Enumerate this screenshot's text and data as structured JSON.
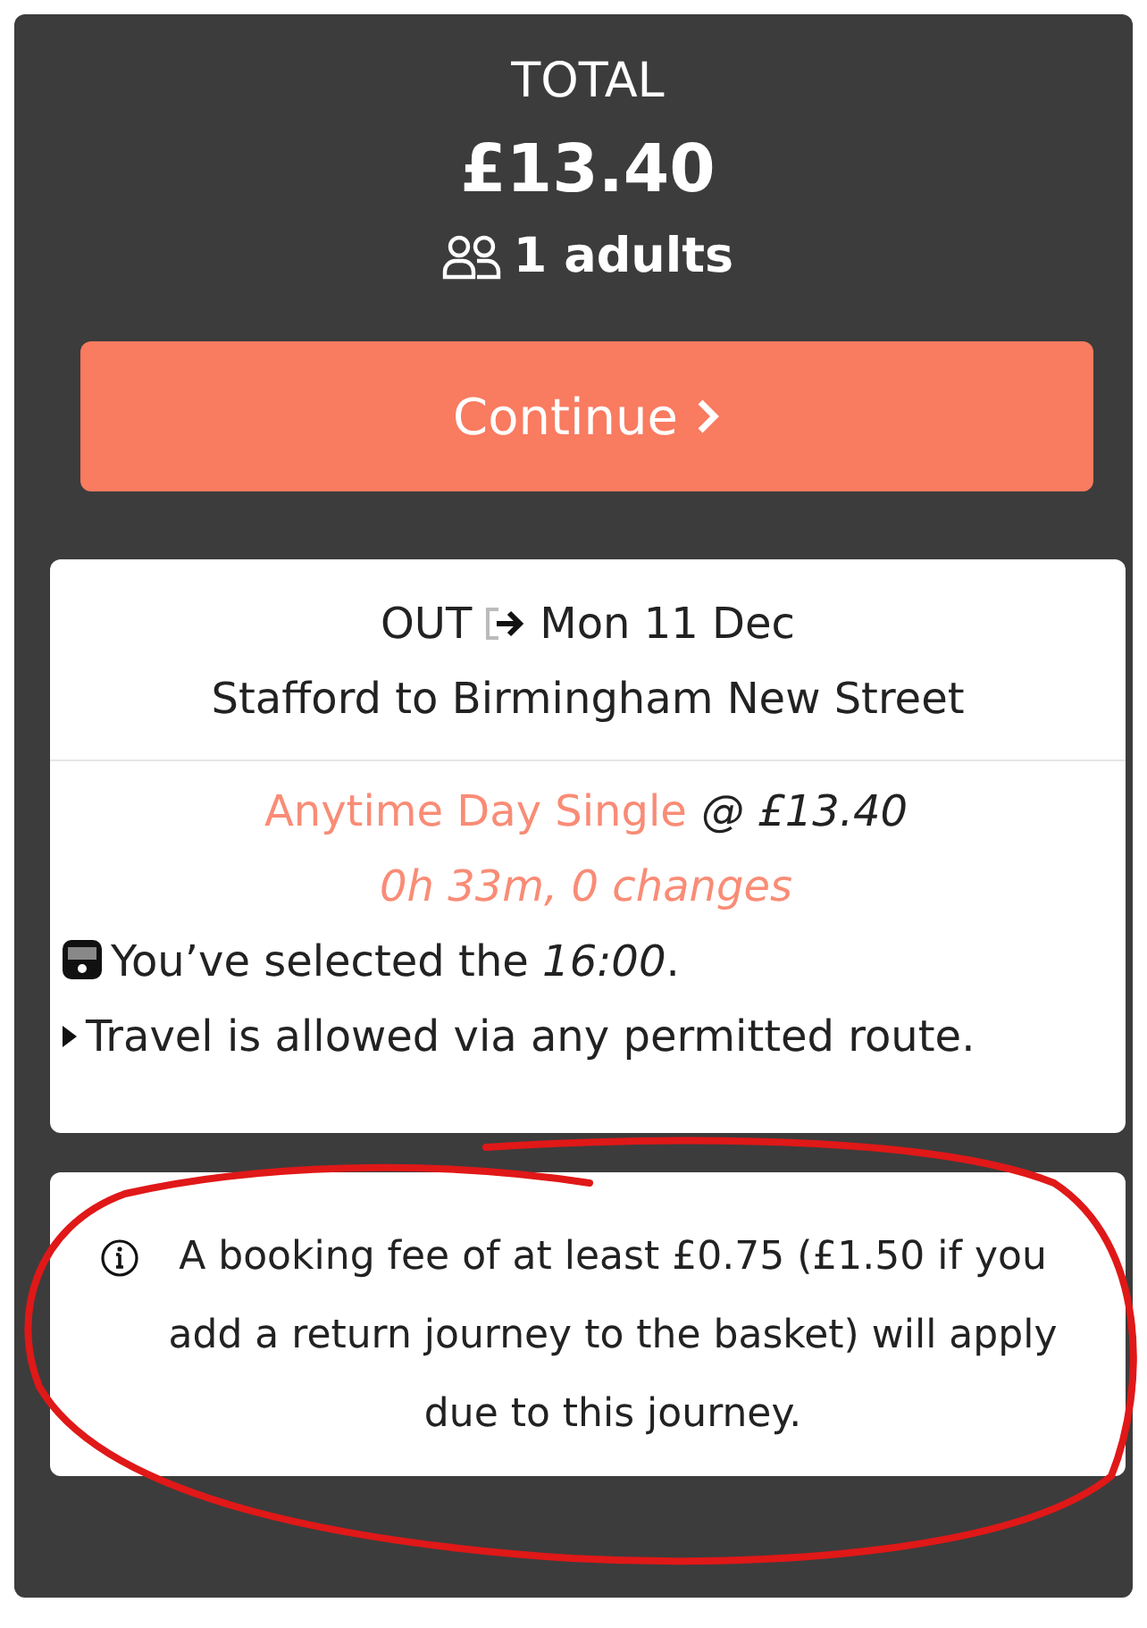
{
  "total": {
    "label": "TOTAL",
    "amount": "£13.40",
    "passengers": "1 adults"
  },
  "continue_button": {
    "label": "Continue"
  },
  "journey": {
    "direction": "OUT",
    "date": "Mon 11 Dec",
    "route": "Stafford to Birmingham New Street",
    "fare_name": "Anytime Day Single",
    "fare_price": "@ £13.40",
    "duration": "0h 33m, 0 changes",
    "notes": [
      {
        "kind": "train",
        "text": "You’ve selected the *16:00*."
      },
      {
        "kind": "bullet",
        "text": "Travel is allowed via any permitted route."
      }
    ]
  },
  "notice": {
    "text": "A booking fee of at least £0.75 (£1.50 if you add a return journey to the basket) will apply due to this journey.",
    "annotated": true
  }
}
